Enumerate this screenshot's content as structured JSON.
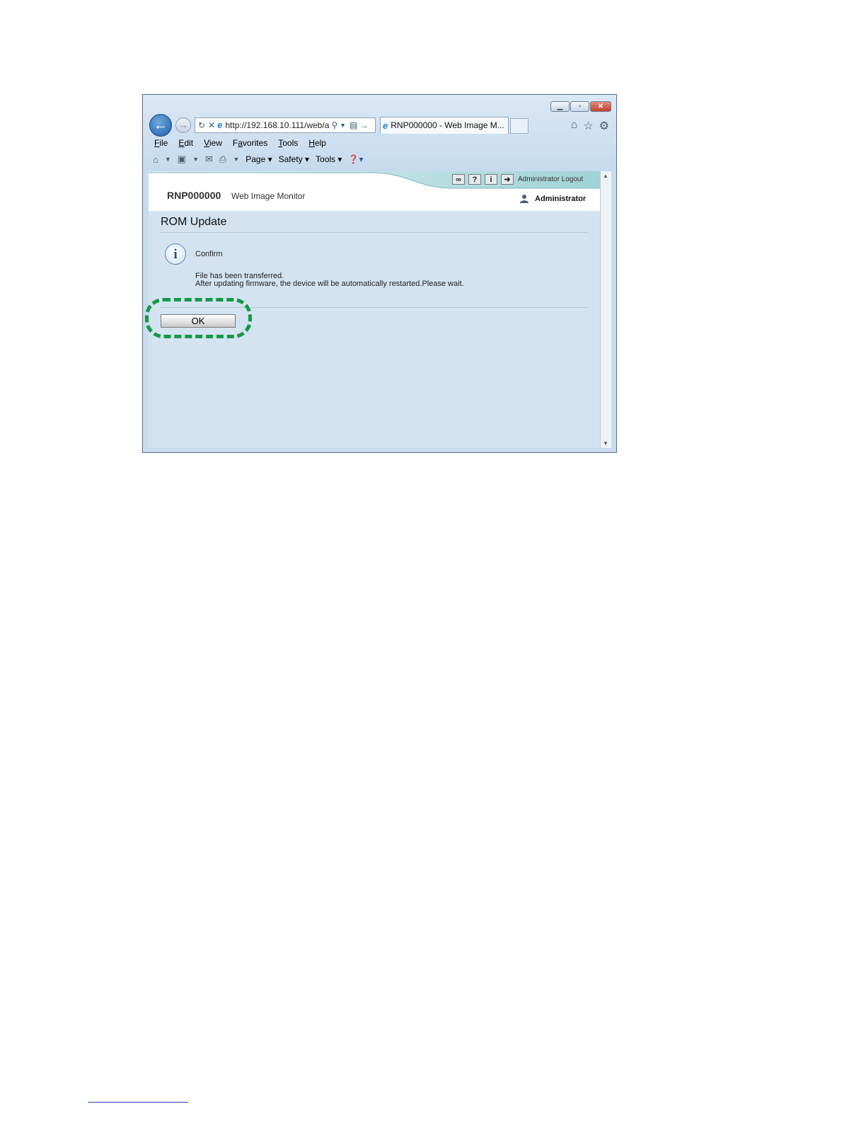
{
  "browser": {
    "address": "http://192.168.10.111/web/a",
    "tab_title": "RNP000000 - Web Image M...",
    "menu": [
      "File",
      "Edit",
      "View",
      "Favorites",
      "Tools",
      "Help"
    ],
    "menu_access": [
      "F",
      "E",
      "V",
      "a",
      "T",
      "H"
    ],
    "command_bar": {
      "page": "Page",
      "safety": "Safety",
      "tools": "Tools"
    }
  },
  "header": {
    "product": "RNP000000",
    "subtitle": "Web Image Monitor",
    "admin_logout": "Administrator  Logout",
    "user": "Administrator"
  },
  "page": {
    "title": "ROM Update",
    "confirm_label": "Confirm",
    "message_line1": "File has been transferred.",
    "message_line2": "After updating firmware, the device will be automatically restarted.Please wait.",
    "ok_button": "OK"
  },
  "icons": {
    "back": "back-arrow-icon",
    "forward": "forward-arrow-icon",
    "info": "info-icon",
    "highlight": "dashed-callout"
  },
  "colors": {
    "highlight": "#139a45",
    "content_bg": "#d4e3f0",
    "frame": "#c8dcef"
  }
}
